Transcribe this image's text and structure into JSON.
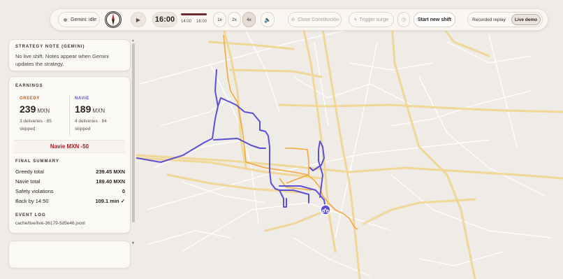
{
  "toolbar": {
    "status": "Gemini: idle",
    "clock": "16:00",
    "progress_fraction": 1.0,
    "time_start": "14:00",
    "time_end": "16:00",
    "speeds": [
      "1x",
      "2x",
      "4x"
    ],
    "selected_speed": "4x",
    "close_label": "Close Constitución",
    "surge_label": "Trigger surge",
    "start_label": "Start new shift",
    "modes": [
      "Recorded replay",
      "Live demo"
    ],
    "selected_mode": "Live demo",
    "icons": {
      "status": "status-dot-icon",
      "compass": "compass-icon",
      "play": "play-icon",
      "sound": "speaker-icon",
      "close": "close-circle-icon",
      "surge": "lightning-icon",
      "timer": "clock-icon"
    }
  },
  "strategy": {
    "label": "STRATEGY NOTE (GEMINI)",
    "text": "No live shift. Notes appear when Gemini updates the strategy."
  },
  "earnings": {
    "label": "EARNINGS",
    "greedy": {
      "label": "GREEDY",
      "amount": "239",
      "unit": "MXN",
      "deliveries": "3 deliveries · 85",
      "skipped": "skipped",
      "color": "#b0652a"
    },
    "navie": {
      "label": "NAVIE",
      "amount": "189",
      "unit": "MXN",
      "deliveries": "4 deliveries · 84",
      "skipped": "skipped",
      "color": "#5a4fd0"
    },
    "diff": "Navie MXN -50",
    "diff_color": "#a41a26"
  },
  "summary": {
    "label": "FINAL SUMMARY",
    "rows": [
      {
        "label": "Greedy total",
        "value": "239.45 MXN"
      },
      {
        "label": "Navie total",
        "value": "189.40 MXN"
      },
      {
        "label": "Safety violations",
        "value": "0"
      },
      {
        "label": "Back by 14:50",
        "value": "109.1 min ✓"
      }
    ]
  },
  "event_log": {
    "label": "EVENT LOG",
    "path": "cache/live/live-36179-5d5e46.jsonl"
  },
  "map": {
    "road_color": "#f1d58f",
    "greedy_route_color": "#f0a93b",
    "navie_route_color": "#5b4fd6",
    "courier_icon": "bicycle-icon"
  }
}
